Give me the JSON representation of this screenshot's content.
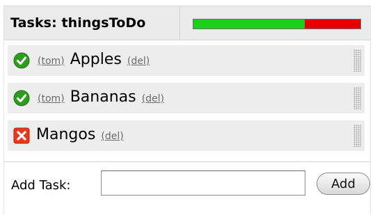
{
  "header": {
    "title": "Tasks: thingsToDo",
    "progress": {
      "done": 2,
      "total": 3,
      "done_color": "#19d119",
      "remaining_color": "#e60000"
    }
  },
  "tasks": [
    {
      "status": "done",
      "status_icon": "check-circle-icon",
      "user": "(tom)",
      "name": "Apples",
      "del": "(del)"
    },
    {
      "status": "done",
      "status_icon": "check-circle-icon",
      "user": "(tom)",
      "name": "Bananas",
      "del": "(del)"
    },
    {
      "status": "not-done",
      "status_icon": "x-square-icon",
      "user": "",
      "name": "Mangos",
      "del": "(del)"
    }
  ],
  "add_task": {
    "label": "Add Task:",
    "value": "",
    "placeholder": "",
    "button_label": "Add"
  }
}
